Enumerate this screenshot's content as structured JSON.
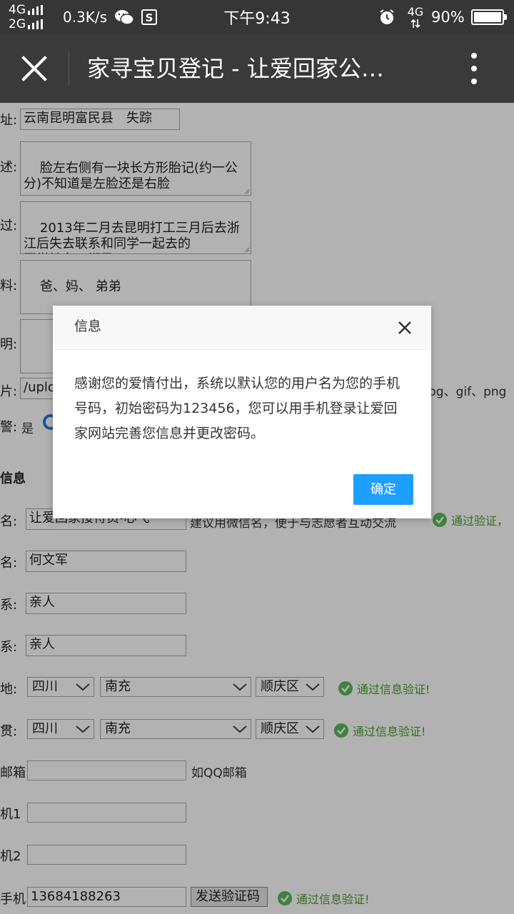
{
  "status_bar": {
    "network_top": "4G",
    "network_bottom": "2G",
    "speed": "0.3K/s",
    "time": "下午9:43",
    "data_network": "4G",
    "battery": "90%",
    "icons": [
      "wechat-icon",
      "s-icon",
      "alarm-icon",
      "battery-icon"
    ]
  },
  "title_bar": {
    "title": "家寻宝贝登记 - 让爱回家公…",
    "icons": [
      "close-icon",
      "more-vert-icon"
    ]
  },
  "form": {
    "address": {
      "label": "址:",
      "value": "云南昆明富民县　失踪"
    },
    "description": {
      "label": "述:",
      "value": "脸左右侧有一块长方形胎记(约一公分)不知道是左脸还是右脸"
    },
    "process": {
      "label": "过:",
      "value": "2013年二月去昆明打工三月后去浙江后失去联系和同学一起去的\n同学姓名：郑勇"
    },
    "family": {
      "label": "料:",
      "value": "爸、妈、 弟弟"
    },
    "explanation": {
      "label": "明:",
      "value": ""
    },
    "photo": {
      "label": "片:",
      "value": "/uplo",
      "hint": "pg、gif、png"
    },
    "police": {
      "label": "警:",
      "option": "是"
    },
    "section_title": "信息",
    "nickname": {
      "label": "名:",
      "value": "让爱回家接待员-心弋",
      "hint": "建议用微信名，便于与志愿者互动交流",
      "status": "通过验证，"
    },
    "realname": {
      "label": "名:",
      "value": "何文军"
    },
    "relation1": {
      "label": "系:",
      "value": "亲人"
    },
    "relation2": {
      "label": "系:",
      "value": "亲人"
    },
    "location": {
      "label": "地:",
      "province": "四川",
      "city": "南充",
      "district": "顺庆区",
      "status": "通过信息验证!"
    },
    "hometown": {
      "label": "贯:",
      "province": "四川",
      "city": "南充",
      "district": "顺庆区",
      "status": "通过信息验证!"
    },
    "email": {
      "label": "邮箱",
      "value": "",
      "hint": "如QQ邮箱"
    },
    "phone1": {
      "label": "机1",
      "value": ""
    },
    "phone2": {
      "label": "机2",
      "value": ""
    },
    "mobile": {
      "label": "手机",
      "value": "13684188263",
      "button": "发送验证码",
      "status": "通过信息验证!"
    }
  },
  "dialog": {
    "title": "信息",
    "message": "感谢您的爱情付出，系统以默认您的用户名为您的手机号码，初始密码为123456，您可以用手机登录让爱回家网站完善您信息并更改密码。",
    "confirm": "确定"
  },
  "colors": {
    "status_bar": "#363636",
    "title_bar": "#3a3a3a",
    "ok_green": "#4aa02c",
    "confirm_blue": "#1e9fff"
  }
}
